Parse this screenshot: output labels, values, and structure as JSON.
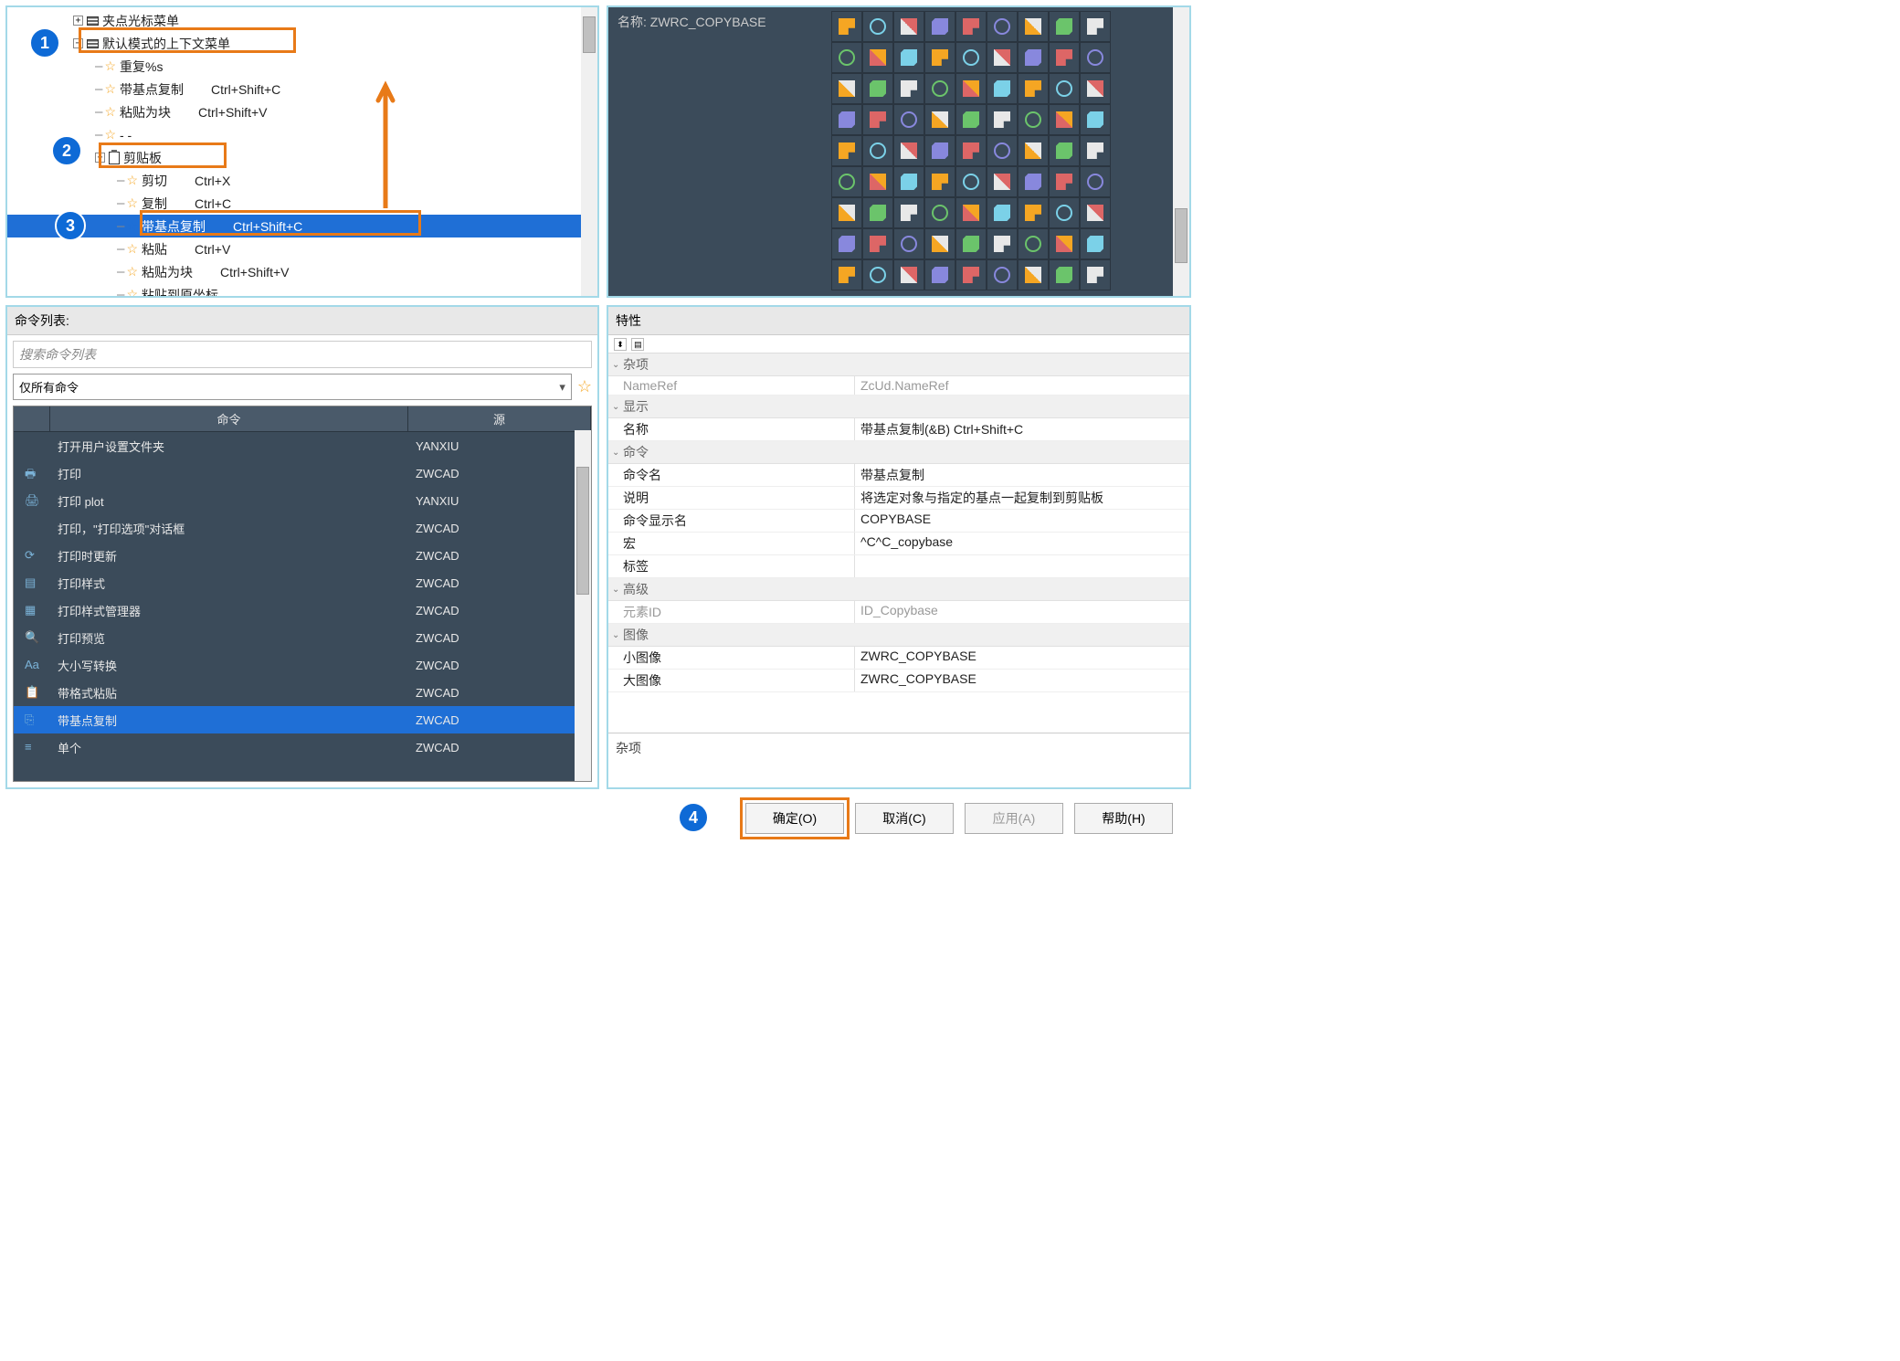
{
  "tree": {
    "items": [
      {
        "indent": 3,
        "expander": "+",
        "icon": "menu",
        "label": "夹点光标菜单",
        "shortcut": ""
      },
      {
        "indent": 3,
        "expander": "-",
        "icon": "menu",
        "label": "默认模式的上下文菜单",
        "shortcut": ""
      },
      {
        "indent": 4,
        "star": true,
        "label": "重复%s",
        "shortcut": ""
      },
      {
        "indent": 4,
        "star": true,
        "label": "带基点复制",
        "shortcut": "Ctrl+Shift+C"
      },
      {
        "indent": 4,
        "star": true,
        "label": "粘贴为块",
        "shortcut": "Ctrl+Shift+V"
      },
      {
        "indent": 4,
        "star": true,
        "label": "- -",
        "shortcut": ""
      },
      {
        "indent": 4,
        "expander": "-",
        "icon": "clipboard",
        "label": "剪贴板",
        "shortcut": ""
      },
      {
        "indent": 5,
        "star": true,
        "label": "剪切",
        "shortcut": "Ctrl+X"
      },
      {
        "indent": 5,
        "star": true,
        "label": "复制",
        "shortcut": "Ctrl+C"
      },
      {
        "indent": 5,
        "star": true,
        "label": "带基点复制",
        "shortcut": "Ctrl+Shift+C",
        "selected": true
      },
      {
        "indent": 5,
        "star": true,
        "label": "粘贴",
        "shortcut": "Ctrl+V"
      },
      {
        "indent": 5,
        "star": true,
        "label": "粘贴为块",
        "shortcut": "Ctrl+Shift+V"
      },
      {
        "indent": 5,
        "star": true,
        "label": "粘贴到原坐标",
        "shortcut": ""
      }
    ]
  },
  "palette": {
    "name_label": "名称:",
    "name_value": "ZWRC_COPYBASE"
  },
  "cmdlist": {
    "title": "命令列表:",
    "search_placeholder": "搜索命令列表",
    "filter": "仅所有命令",
    "columns": {
      "cmd": "命令",
      "src": "源"
    },
    "rows": [
      {
        "icon": "",
        "cmd": "打开用户设置文件夹",
        "src": "YANXIU"
      },
      {
        "icon": "print",
        "cmd": "打印",
        "src": "ZWCAD"
      },
      {
        "icon": "printer",
        "cmd": "打印 plot",
        "src": "YANXIU"
      },
      {
        "icon": "",
        "cmd": "打印，\"打印选项\"对话框",
        "src": "ZWCAD"
      },
      {
        "icon": "refresh",
        "cmd": "打印时更新",
        "src": "ZWCAD"
      },
      {
        "icon": "style",
        "cmd": "打印样式",
        "src": "ZWCAD"
      },
      {
        "icon": "stylemgr",
        "cmd": "打印样式管理器",
        "src": "ZWCAD"
      },
      {
        "icon": "preview",
        "cmd": "打印预览",
        "src": "ZWCAD"
      },
      {
        "icon": "aa",
        "cmd": "大小写转换",
        "src": "ZWCAD"
      },
      {
        "icon": "paste",
        "cmd": "带格式粘贴",
        "src": "ZWCAD"
      },
      {
        "icon": "copybase",
        "cmd": "带基点复制",
        "src": "ZWCAD",
        "selected": true
      },
      {
        "icon": "list",
        "cmd": "单个",
        "src": "ZWCAD"
      }
    ]
  },
  "props": {
    "title": "特性",
    "categories": [
      {
        "name": "杂项",
        "rows": [
          {
            "name": "NameRef",
            "val": "ZcUd.NameRef",
            "disabled": true
          }
        ]
      },
      {
        "name": "显示",
        "rows": [
          {
            "name": "名称",
            "val": "带基点复制(&B)        Ctrl+Shift+C"
          }
        ]
      },
      {
        "name": "命令",
        "rows": [
          {
            "name": "命令名",
            "val": "带基点复制"
          },
          {
            "name": "说明",
            "val": "将选定对象与指定的基点一起复制到剪贴板"
          },
          {
            "name": "命令显示名",
            "val": "COPYBASE"
          },
          {
            "name": "宏",
            "val": "^C^C_copybase"
          },
          {
            "name": "标签",
            "val": ""
          }
        ]
      },
      {
        "name": "高级",
        "rows": [
          {
            "name": "元素ID",
            "val": "ID_Copybase",
            "disabled": true
          }
        ]
      },
      {
        "name": "图像",
        "rows": [
          {
            "name": "小图像",
            "val": "ZWRC_COPYBASE"
          },
          {
            "name": "大图像",
            "val": "ZWRC_COPYBASE"
          }
        ]
      }
    ],
    "desc": "杂项"
  },
  "buttons": {
    "ok": "确定(O)",
    "cancel": "取消(C)",
    "apply": "应用(A)",
    "help": "帮助(H)"
  },
  "steps": {
    "1": "1",
    "2": "2",
    "3": "3",
    "4": "4"
  }
}
